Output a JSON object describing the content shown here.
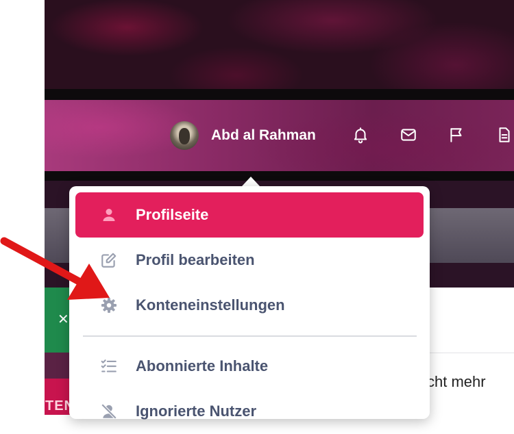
{
  "user": {
    "name": "Abd al Rahman"
  },
  "nav_icons": [
    "bell-icon",
    "mail-icon",
    "flag-icon",
    "document-icon"
  ],
  "menu": {
    "items": [
      {
        "label": "Profilseite",
        "icon": "user-icon",
        "active": true
      },
      {
        "label": "Profil bearbeiten",
        "icon": "edit-icon",
        "active": false
      },
      {
        "label": "Konteneinstellungen",
        "icon": "gear-icon",
        "active": false
      },
      {
        "label": "Abonnierte Inhalte",
        "icon": "checklist-icon",
        "active": false
      },
      {
        "label": "Ignorierte Nutzer",
        "icon": "user-slash-icon",
        "active": false
      }
    ]
  },
  "background": {
    "panel_text": "cht mehr",
    "side_text": "TEN",
    "close_glyph": "✕"
  },
  "colors": {
    "accent": "#e31f5c",
    "menu_text": "#4a5470",
    "annotation_arrow": "#e01818"
  }
}
